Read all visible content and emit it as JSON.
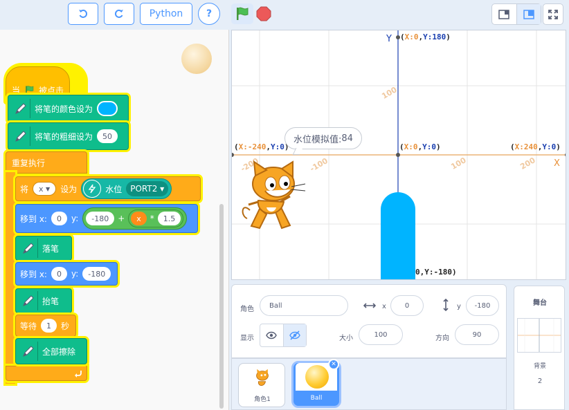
{
  "toolbar": {
    "undo_icon": "undo-icon",
    "redo_icon": "redo-icon",
    "python_label": "Python",
    "help_label": "?",
    "green_flag_icon": "green-flag-icon",
    "stop_icon": "stop-icon"
  },
  "code": {
    "hat": {
      "when": "当",
      "clicked": "被点击"
    },
    "set_pen_color": {
      "label": "将笔的颜色设为",
      "color": "#00b4ff"
    },
    "set_pen_size": {
      "label": "将笔的粗细设为",
      "value": "50"
    },
    "forever": {
      "label": "重复执行"
    },
    "set_var": {
      "set_label": "将",
      "var": "x",
      "to_label": "设为",
      "sensor_label": "水位",
      "port": "PORT2"
    },
    "goto1": {
      "label": "移到 x:",
      "x": "0",
      "y_label": "y:",
      "y_left": "-180",
      "plus": "+",
      "var": "x",
      "times": "*",
      "factor": "1.5"
    },
    "pen_down": {
      "label": "落笔"
    },
    "goto2": {
      "label": "移到 x:",
      "x": "0",
      "y_label": "y:",
      "y": "-180"
    },
    "pen_up": {
      "label": "抬笔"
    },
    "wait": {
      "label": "等待",
      "value": "1",
      "unit": "秒"
    },
    "clear": {
      "label": "全部擦除"
    }
  },
  "stage": {
    "y_axis": "Y",
    "x_axis": "X",
    "top_coord": {
      "x": "X:0",
      "y": "Y:180"
    },
    "center_coord": {
      "x": "X:0",
      "y": "Y:0"
    },
    "left_coord": {
      "x": "X:-240",
      "y": "Y:0"
    },
    "right_coord": {
      "x": "X:240",
      "y": "Y:0"
    },
    "bottom_coord": "0,Y:-180)",
    "speech_label": "水位模拟值:",
    "speech_value": "84",
    "tick_neg200": "-200",
    "tick_neg100": "-100",
    "tick_100x": "100",
    "tick_200": "200",
    "tick_100y": "100",
    "bar_color": "#00b4ff",
    "bar_level": 84
  },
  "sprite_info": {
    "sprite_label": "角色",
    "sprite_name": "Ball",
    "x_label": "x",
    "x_value": "0",
    "y_label": "y",
    "y_value": "-180",
    "show_label": "显示",
    "size_label": "大小",
    "size_value": "100",
    "direction_label": "方向",
    "direction_value": "90"
  },
  "sprites": [
    {
      "name": "角色1"
    },
    {
      "name": "Ball"
    }
  ],
  "stage_panel": {
    "title": "舞台",
    "backdrop_label": "背景",
    "backdrop_count": "2"
  }
}
